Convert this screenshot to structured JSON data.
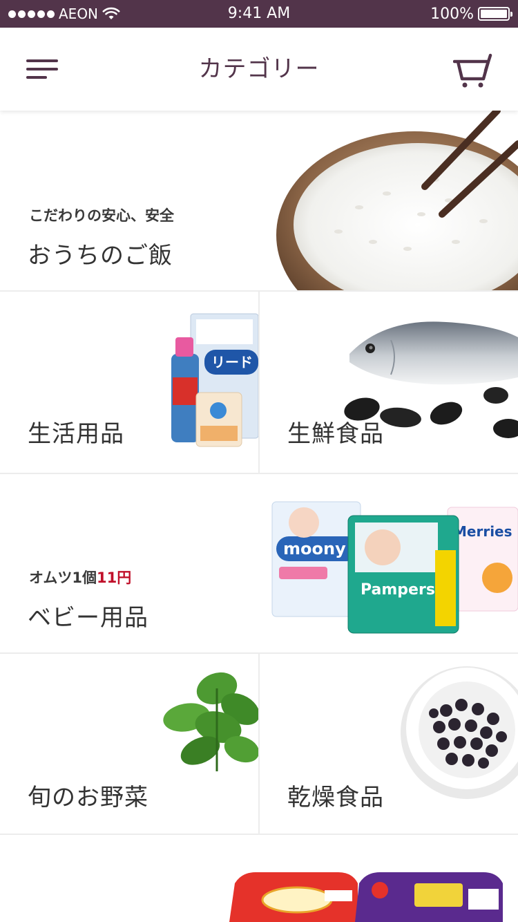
{
  "status_bar": {
    "carrier": "AEON",
    "time": "9:41 AM",
    "battery": "100%"
  },
  "nav": {
    "title": "カテゴリー",
    "menu_icon": "hamburger-menu-icon",
    "cart_icon": "cart-icon"
  },
  "categories": [
    {
      "subtitle": "こだわりの安心、安全",
      "title": "おうちのご飯",
      "image": "rice-bowl-chopsticks"
    },
    {
      "title": "生活用品",
      "image": "household-products"
    },
    {
      "title": "生鮮食品",
      "image": "fish-and-mussels"
    },
    {
      "subtitle_prefix": "オムツ1個",
      "subtitle_highlight": "11円",
      "title": "ベビー用品",
      "image": "diaper-packages"
    },
    {
      "title": "旬のお野菜",
      "image": "basil-leaves"
    },
    {
      "title": "乾燥食品",
      "image": "bowl-of-dried-berries"
    },
    {
      "image": "instant-noodle-packs"
    }
  ],
  "colors": {
    "brand": "#52344a",
    "highlight": "#c0102a",
    "separator": "#ececec"
  }
}
